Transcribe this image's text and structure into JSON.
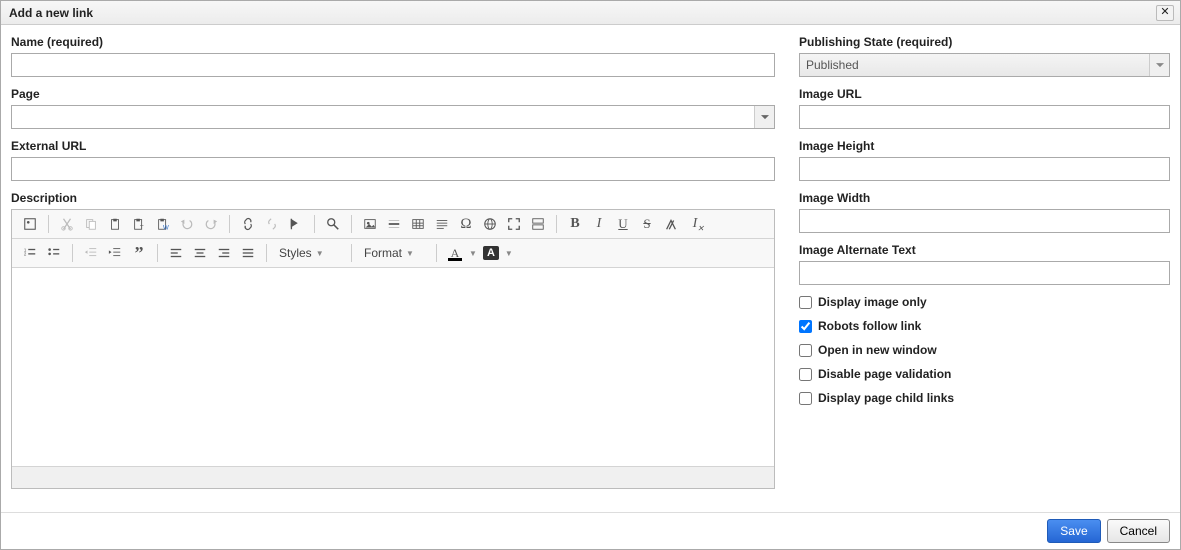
{
  "dialog": {
    "title": "Add a new link"
  },
  "left": {
    "name_label": "Name (required)",
    "name_value": "",
    "page_label": "Page",
    "page_value": "",
    "exturl_label": "External URL",
    "exturl_value": "",
    "description_label": "Description"
  },
  "toolbar": {
    "styles_label": "Styles",
    "format_label": "Format"
  },
  "right": {
    "pubstate_label": "Publishing State (required)",
    "pubstate_value": "Published",
    "imageurl_label": "Image URL",
    "imageurl_value": "",
    "imageheight_label": "Image Height",
    "imageheight_value": "",
    "imagewidth_label": "Image Width",
    "imagewidth_value": "",
    "imagealt_label": "Image Alternate Text",
    "imagealt_value": "",
    "chk_displayimage_label": "Display image only",
    "chk_robots_label": "Robots follow link",
    "chk_newwindow_label": "Open in new window",
    "chk_disablevalidation_label": "Disable page validation",
    "chk_childlinks_label": "Display page child links"
  },
  "footer": {
    "save_label": "Save",
    "cancel_label": "Cancel"
  }
}
